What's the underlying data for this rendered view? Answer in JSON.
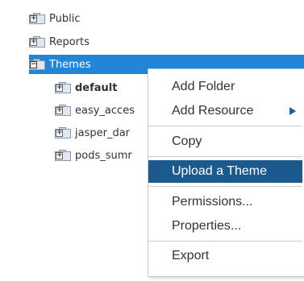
{
  "tree": {
    "items": [
      {
        "label": "Public",
        "expander": "+"
      },
      {
        "label": "Reports",
        "expander": "+"
      },
      {
        "label": "Themes",
        "expander": "−",
        "selected": true
      },
      {
        "label": "default",
        "expander": "+",
        "bold": true
      },
      {
        "label": "easy_acces",
        "expander": "+"
      },
      {
        "label": "jasper_dar",
        "expander": "+"
      },
      {
        "label": "pods_sumr",
        "expander": "+"
      }
    ]
  },
  "context_menu": {
    "items": [
      {
        "label": "Add Folder"
      },
      {
        "label": "Add Resource",
        "submenu": true
      },
      {
        "label": "Copy"
      },
      {
        "label": "Upload a Theme",
        "highlighted": true
      },
      {
        "label": "Permissions..."
      },
      {
        "label": "Properties..."
      },
      {
        "label": "Export"
      }
    ]
  },
  "colors": {
    "selection": "#1f86d8",
    "menu_highlight": "#1c5a8e",
    "submenu_arrow": "#1f5fa0"
  }
}
